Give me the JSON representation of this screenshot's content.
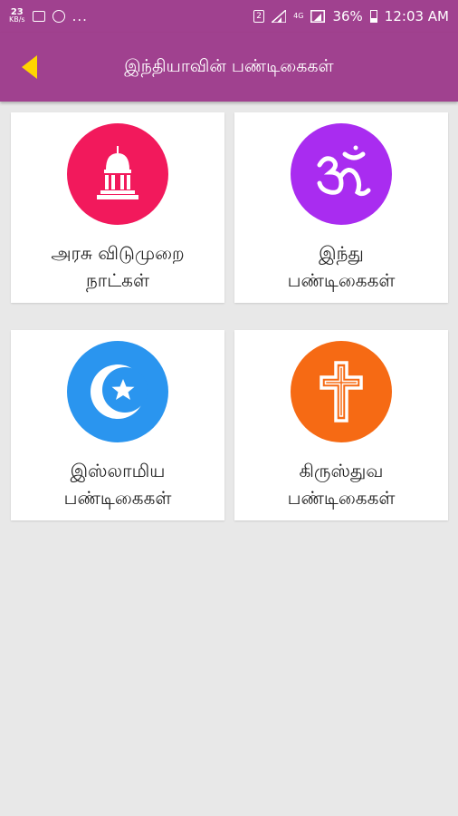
{
  "status_bar": {
    "net_speed_value": "23",
    "net_speed_unit": "KB/s",
    "lte": "4G",
    "battery": "36%",
    "time": "12:03 AM",
    "sim_label": "2",
    "overflow": "...",
    "icons": [
      "image-icon",
      "whatsapp-icon",
      "sim2-icon",
      "signal-icon",
      "battery-icon"
    ]
  },
  "appbar": {
    "title": "இந்தியாவின் பண்டிகைகள்",
    "back_icon": "back-arrow-icon",
    "accent_color": "#a0418f",
    "back_color": "#ffd500"
  },
  "categories": [
    {
      "line1": "அரசு விடுமுறை",
      "line2": "நாட்கள்",
      "icon": "capitol-icon",
      "color": "#f2195c"
    },
    {
      "line1": "இந்து",
      "line2": "பண்டிகைகள்",
      "icon": "om-icon",
      "color": "#a92cf0"
    },
    {
      "line1": "இஸ்லாமிய",
      "line2": "பண்டிகைகள்",
      "icon": "crescent-star-icon",
      "color": "#2a95ef"
    },
    {
      "line1": "கிருஸ்துவ",
      "line2": "பண்டிகைகள்",
      "icon": "cross-icon",
      "color": "#f66a14"
    }
  ]
}
